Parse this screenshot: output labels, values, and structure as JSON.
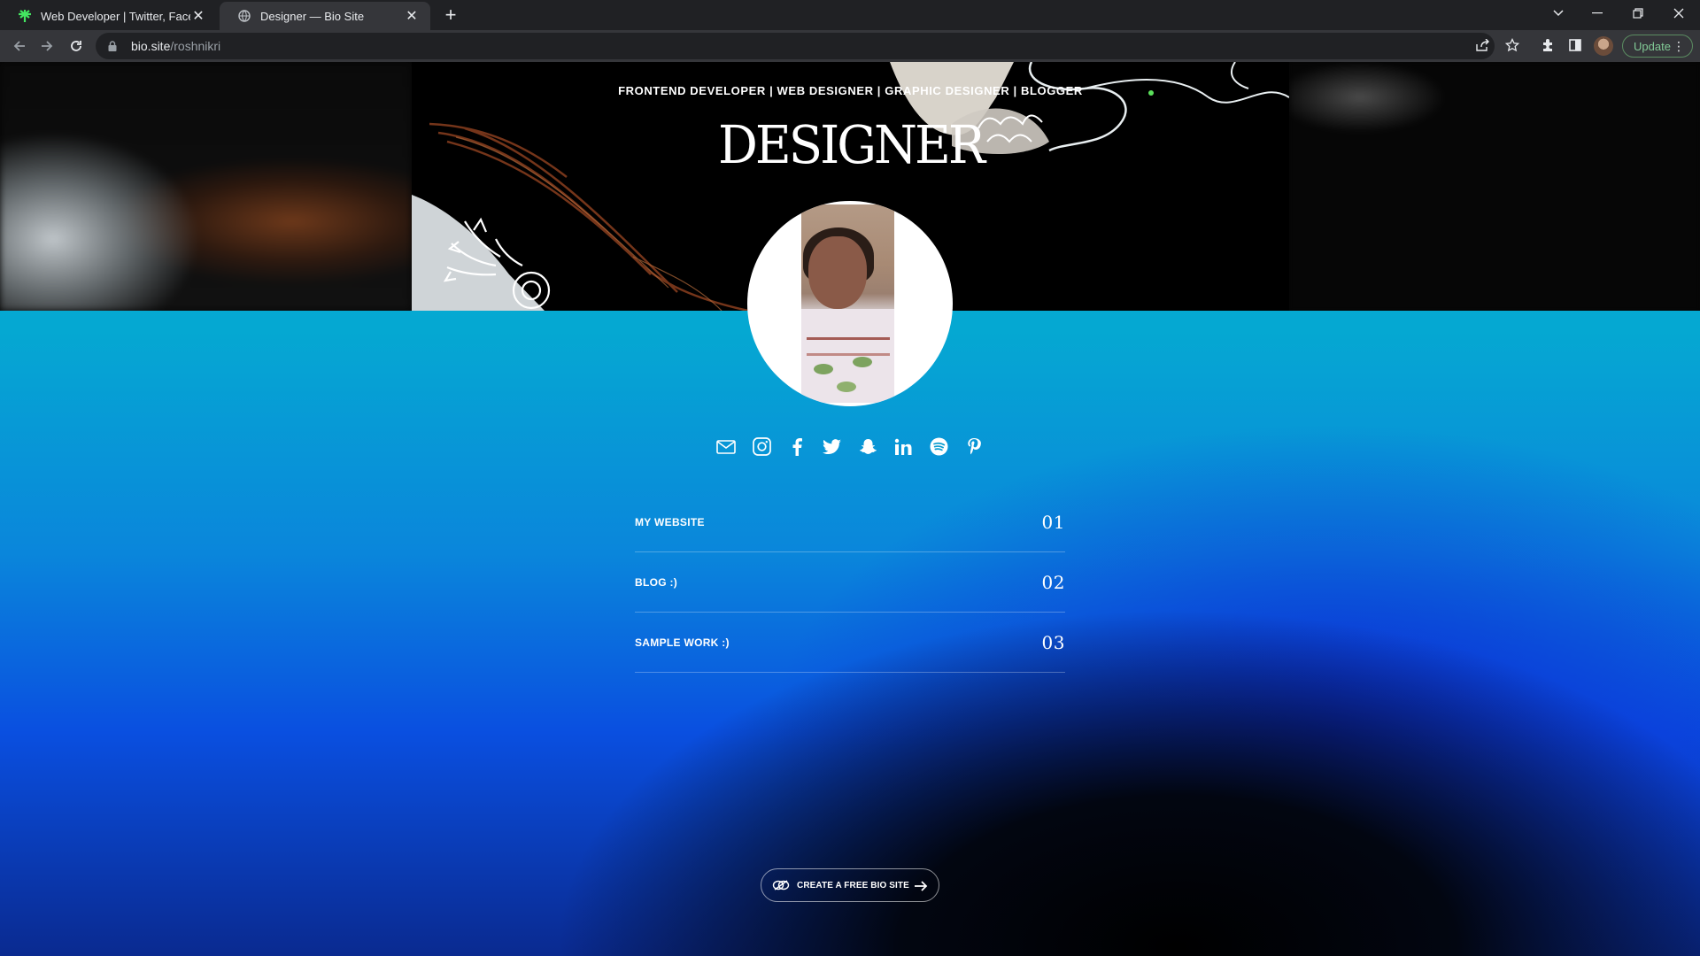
{
  "browser": {
    "tabs": [
      {
        "title": "Web Developer | Twitter, Facebook",
        "favicon": "linktree-icon",
        "active": false
      },
      {
        "title": "Designer — Bio Site",
        "favicon": "globe-icon",
        "active": true
      }
    ],
    "new_tab_label": "+",
    "url_host": "bio.site",
    "url_path": "/roshnikri",
    "update_label": "Update",
    "accent_update": "#81c995"
  },
  "header": {
    "tagline": "FRONTEND DEVELOPER | WEB DESIGNER | GRAPHIC DESIGNER | BLOGGER",
    "brand": "DESIGNER"
  },
  "socials": [
    {
      "name": "email-icon"
    },
    {
      "name": "instagram-icon"
    },
    {
      "name": "facebook-icon"
    },
    {
      "name": "twitter-icon"
    },
    {
      "name": "snapchat-icon"
    },
    {
      "name": "linkedin-icon"
    },
    {
      "name": "spotify-icon"
    },
    {
      "name": "pinterest-icon"
    }
  ],
  "links": [
    {
      "label": "MY WEBSITE",
      "number": "01"
    },
    {
      "label": "BLOG :)",
      "number": "02"
    },
    {
      "label": "SAMPLE WORK :)",
      "number": "03"
    }
  ],
  "cta": {
    "label": "CREATE A FREE BIO SITE"
  },
  "colors": {
    "page_top": "#05b3cd",
    "page_bottom": "#0a2a90",
    "text": "#ffffff"
  }
}
